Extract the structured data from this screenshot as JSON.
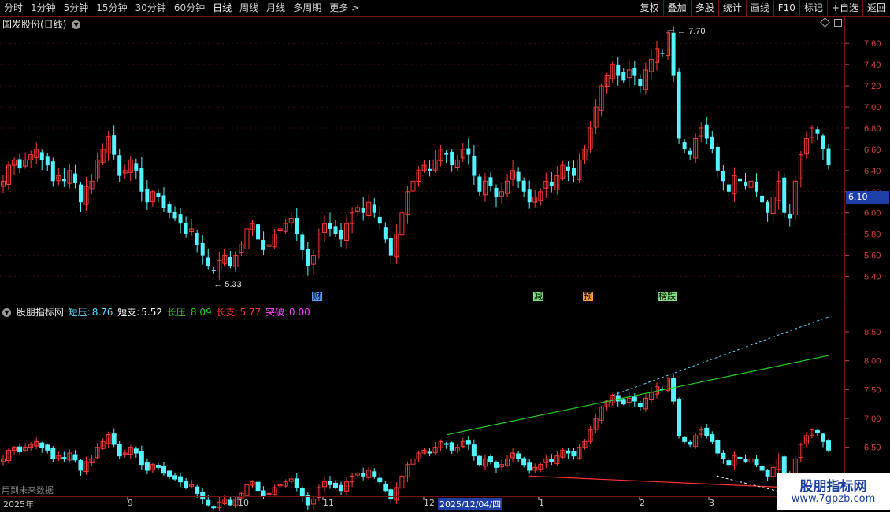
{
  "toolbar": {
    "periods": [
      "分时",
      "1分钟",
      "5分钟",
      "15分钟",
      "30分钟",
      "60分钟",
      "日线",
      "周线",
      "月线",
      "多周期",
      "更多 >"
    ],
    "active": "日线",
    "actions": [
      "复权",
      "叠加",
      "多股",
      "统计",
      "画线",
      "F10",
      "标记",
      "+自选",
      "返回"
    ]
  },
  "stock": {
    "title": "国发股份(日线)"
  },
  "price_axis": [
    "7.60",
    "7.40",
    "7.20",
    "7.00",
    "6.80",
    "6.60",
    "6.40",
    "6.20",
    "6.00",
    "5.80",
    "5.60",
    "5.40"
  ],
  "current_price": "6.10",
  "markers": {
    "high": "7.70",
    "low": "5.33"
  },
  "events": [
    {
      "label": "财",
      "color": "#5aa0ff"
    },
    {
      "label": "减",
      "color": "#7fe07f"
    },
    {
      "label": "预",
      "color": "#ff9a40"
    },
    {
      "label": "榜跌",
      "color": "#7fe07f"
    }
  ],
  "indicator": {
    "name": "股朋指标网",
    "items": [
      {
        "label": "短压:",
        "value": "8.76",
        "color": "#57d8ff"
      },
      {
        "label": "短支:",
        "value": "5.52",
        "color": "#ffffff"
      },
      {
        "label": "长压:",
        "value": "8.09",
        "color": "#22d022"
      },
      {
        "label": "长支:",
        "value": "5.77",
        "color": "#ff3030"
      },
      {
        "label": "突破:",
        "value": "0.00",
        "color": "#ff40ff"
      }
    ]
  },
  "ind_axis": [
    "8.50",
    "8.00",
    "7.50",
    "7.00",
    "6.50",
    "6.00"
  ],
  "future_note": "用到未来数据",
  "time_axis": [
    "2025年",
    "9",
    "10",
    "11",
    "12",
    "2025/12/04/四",
    "1",
    "2",
    "3"
  ],
  "watermark": {
    "line1": "股朋指标网",
    "line2": "www.7gpzb.com"
  },
  "chart_data": {
    "type": "candlestick",
    "title": "国发股份(日线)",
    "high_label": 7.7,
    "low_label": 5.33,
    "last_price": 6.1,
    "y_range_main": [
      5.3,
      7.75
    ],
    "y_range_indicator": [
      5.8,
      8.8
    ],
    "close_path": [
      6.3,
      6.45,
      6.5,
      6.42,
      6.5,
      6.55,
      6.6,
      6.5,
      6.45,
      6.3,
      6.35,
      6.3,
      6.4,
      6.28,
      6.1,
      6.25,
      6.3,
      6.5,
      6.6,
      6.72,
      6.55,
      6.35,
      6.4,
      6.5,
      6.4,
      6.2,
      6.1,
      6.2,
      6.15,
      6.05,
      6.0,
      5.95,
      5.9,
      5.8,
      5.85,
      5.7,
      5.6,
      5.5,
      5.45,
      5.55,
      5.6,
      5.5,
      5.6,
      5.7,
      5.85,
      5.9,
      5.75,
      5.65,
      5.7,
      5.8,
      5.85,
      5.9,
      5.95,
      5.8,
      5.65,
      5.5,
      5.6,
      5.8,
      5.9,
      5.85,
      5.8,
      5.75,
      5.9,
      6.0,
      6.05,
      6.0,
      6.1,
      6.0,
      5.9,
      5.75,
      5.6,
      5.8,
      6.0,
      6.2,
      6.3,
      6.4,
      6.45,
      6.4,
      6.5,
      6.6,
      6.55,
      6.45,
      6.5,
      6.6,
      6.55,
      6.35,
      6.2,
      6.3,
      6.25,
      6.15,
      6.2,
      6.3,
      6.4,
      6.3,
      6.2,
      6.1,
      6.15,
      6.2,
      6.3,
      6.25,
      6.35,
      6.45,
      6.4,
      6.35,
      6.5,
      6.6,
      6.8,
      7.0,
      7.2,
      7.3,
      7.4,
      7.3,
      7.25,
      7.35,
      7.3,
      7.2,
      7.35,
      7.45,
      7.55,
      7.5,
      7.7,
      7.3,
      6.7,
      6.6,
      6.55,
      6.7,
      6.8,
      6.7,
      6.6,
      6.4,
      6.3,
      6.2,
      6.35,
      6.3,
      6.25,
      6.3,
      6.2,
      6.1,
      6.0,
      6.15,
      6.3,
      6.0,
      5.95,
      6.3,
      6.55,
      6.7,
      6.8,
      6.75,
      6.6,
      6.45
    ],
    "long_resistance": [
      [
        568,
        8.09
      ]
    ],
    "series": [
      {
        "name": "短压",
        "value": 8.76
      },
      {
        "name": "短支",
        "value": 5.52
      },
      {
        "name": "长压",
        "value": 8.09
      },
      {
        "name": "长支",
        "value": 5.77
      },
      {
        "name": "突破",
        "value": 0.0
      }
    ]
  }
}
